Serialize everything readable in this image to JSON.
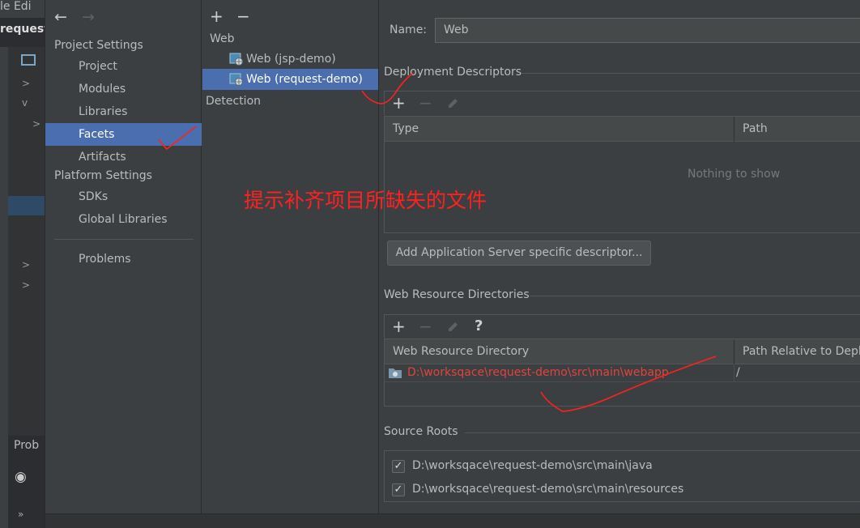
{
  "ide": {
    "menu_text": "le  Edi",
    "project_title": "request",
    "problems_tab": "Prob",
    "more_glyph": "»",
    "eye_glyph": "◉"
  },
  "nav": {
    "back_glyph": "←",
    "forward_glyph": "→",
    "project_settings_header": "Project Settings",
    "project_items": [
      "Project",
      "Modules",
      "Libraries",
      "Facets",
      "Artifacts"
    ],
    "selected_item": "Facets",
    "platform_settings_header": "Platform Settings",
    "platform_items": [
      "SDKs",
      "Global Libraries"
    ],
    "problems": "Problems"
  },
  "tree": {
    "add_glyph": "+",
    "remove_glyph": "−",
    "group_web": "Web",
    "facets": [
      "Web (jsp-demo)",
      "Web (request-demo)"
    ],
    "selected_facet": "Web (request-demo)",
    "detection": "Detection"
  },
  "content": {
    "name_label": "Name:",
    "name_value": "Web",
    "deployment_descriptors": {
      "title": "Deployment Descriptors",
      "columns": [
        "Type",
        "Path"
      ],
      "empty_text": "Nothing to show",
      "add_button": "Add Application Server specific descriptor..."
    },
    "web_resource_directories": {
      "title": "Web Resource Directories",
      "help_glyph": "?",
      "columns": [
        "Web Resource Directory",
        "Path Relative to Deplo"
      ],
      "rows": [
        {
          "directory": "D:\\worksqace\\request-demo\\src\\main\\webapp",
          "relative_path": "/"
        }
      ]
    },
    "source_roots": {
      "title": "Source Roots",
      "items": [
        {
          "path": "D:\\worksqace\\request-demo\\src\\main\\java",
          "checked": true
        },
        {
          "path": "D:\\worksqace\\request-demo\\src\\main\\resources",
          "checked": true
        }
      ]
    }
  },
  "annotation": {
    "text": "提示补齐项目所缺失的文件",
    "color": "#ff2020"
  },
  "colors": {
    "background": "#3c3f41",
    "selection": "#4b6eaf",
    "error_text": "#e0443e"
  }
}
